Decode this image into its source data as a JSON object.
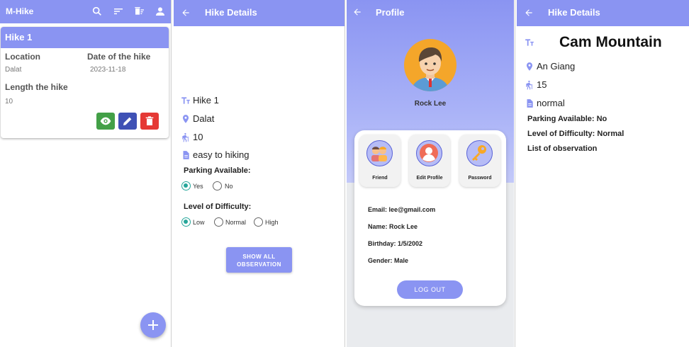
{
  "colors": {
    "primary": "#8a94f2",
    "view": "#43a047",
    "edit": "#3f51b5",
    "delete": "#e53935",
    "radio_on": "#26a69a"
  },
  "list_screen": {
    "app_title": "M-Hike",
    "toolbar_icons": [
      "search-icon",
      "sort-icon",
      "delete-sweep-icon",
      "account-icon"
    ],
    "card": {
      "title": "Hike 1",
      "location_label": "Location",
      "location_value": "Dalat",
      "date_label": "Date of the hike",
      "date_value": "2023-11-18",
      "length_label": "Length the hike",
      "length_value": "10"
    },
    "fab_icon": "plus-icon"
  },
  "detail_screen": {
    "title": "Hike Details",
    "name": "Hike 1",
    "location": "Dalat",
    "length": "10",
    "description": "easy to hiking",
    "parking_label": "Parking Available:",
    "parking_options": [
      "Yes",
      "No"
    ],
    "parking_selected": "Yes",
    "difficulty_label": "Level of Difficulty:",
    "difficulty_options": [
      "Low",
      "Normal",
      "High"
    ],
    "difficulty_selected": "Low",
    "button_line1": "SHOW ALL",
    "button_line2": "OBSERVATION"
  },
  "profile_screen": {
    "title": "Profile",
    "name": "Rock Lee",
    "tiles": [
      "Friend",
      "Edit Profile",
      "Password"
    ],
    "email": "Email: lee@gmail.com",
    "name_line": "Name: Rock Lee",
    "birthday": "Birthday: 1/5/2002",
    "gender": "Gender: Male",
    "logout": "LOG OUT"
  },
  "detail_screen_2": {
    "title": "Hike Details",
    "name": "Cam Mountain",
    "location": "An Giang",
    "length": "15",
    "description": "normal",
    "parking": "Parking Available: No",
    "difficulty": "Level of Difficulty: Normal",
    "observation_label": "List of observation"
  }
}
